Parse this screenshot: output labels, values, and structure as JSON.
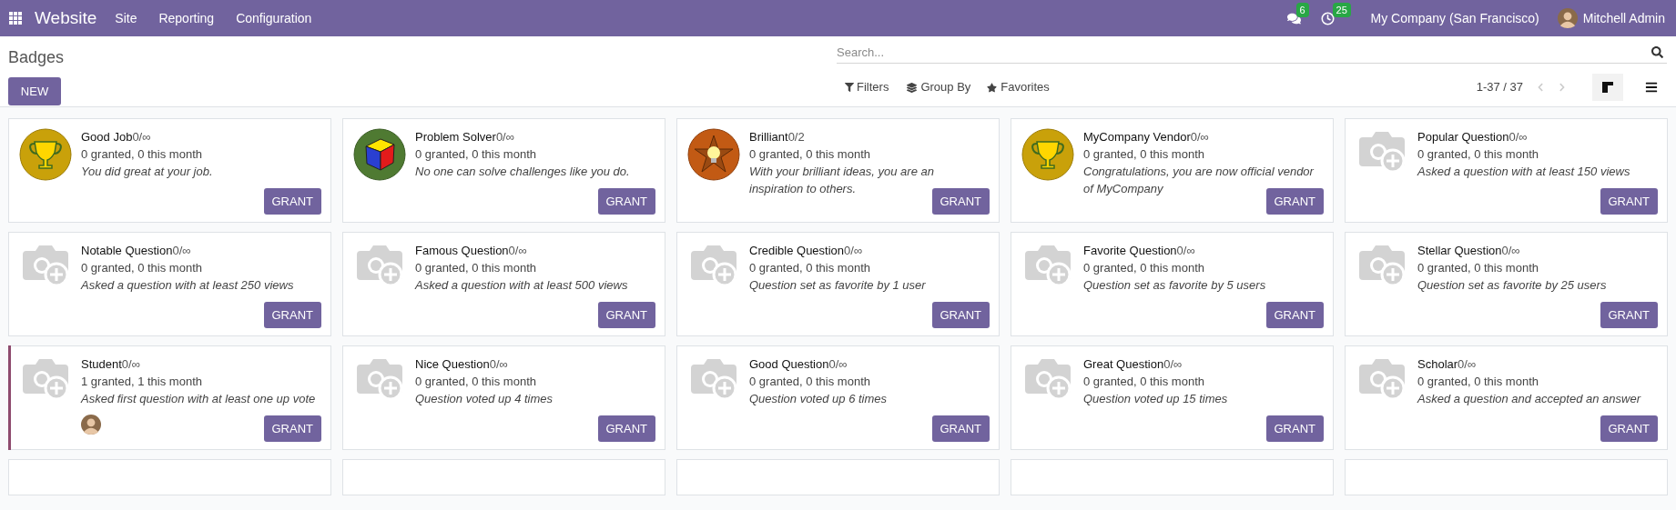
{
  "navbar": {
    "app": "Website",
    "menus": [
      "Site",
      "Reporting",
      "Configuration"
    ],
    "messages_count": "6",
    "activities_count": "25",
    "company": "My Company (San Francisco)",
    "user": "Mitchell Admin"
  },
  "control_panel": {
    "title": "Badges",
    "new_button": "NEW",
    "search": {
      "placeholder": "Search..."
    },
    "filters": "Filters",
    "group_by": "Group By",
    "favorites": "Favorites",
    "pager": "1-37 / 37",
    "views": [
      {
        "kind": "kanban",
        "selected": true
      },
      {
        "kind": "list",
        "selected": false
      }
    ]
  },
  "cards": [
    {
      "kind": "trophy",
      "name": "Good Job",
      "count": "0/∞",
      "granted": "0 granted, 0 this month",
      "description": "You did great at your job.",
      "button": "GRANT",
      "highlighted": false,
      "avatar": false
    },
    {
      "kind": "cube",
      "name": "Problem Solver",
      "count": "0/∞",
      "granted": "0 granted, 0 this month",
      "description": "No one can solve challenges like you do.",
      "button": "GRANT",
      "highlighted": false,
      "avatar": false
    },
    {
      "kind": "star",
      "name": "Brilliant",
      "count": "0/2",
      "granted": "0 granted, 0 this month",
      "description": "With your brilliant ideas, you are an inspiration to others.",
      "button": "GRANT",
      "highlighted": false,
      "avatar": false
    },
    {
      "kind": "trophy",
      "name": "MyCompany Vendor",
      "count": "0/∞",
      "granted": "0 granted, 0 this month",
      "description": "Congratulations, you are now official vendor of MyCompany",
      "button": "GRANT",
      "highlighted": false,
      "avatar": false
    },
    {
      "kind": "placeholder",
      "name": "Popular Question",
      "count": "0/∞",
      "granted": "0 granted, 0 this month",
      "description": "Asked a question with at least 150 views",
      "button": "GRANT",
      "highlighted": false,
      "avatar": false
    },
    {
      "kind": "placeholder",
      "name": "Notable Question",
      "count": "0/∞",
      "granted": "0 granted, 0 this month",
      "description": "Asked a question with at least 250 views",
      "button": "GRANT",
      "highlighted": false,
      "avatar": false
    },
    {
      "kind": "placeholder",
      "name": "Famous Question",
      "count": "0/∞",
      "granted": "0 granted, 0 this month",
      "description": "Asked a question with at least 500 views",
      "button": "GRANT",
      "highlighted": false,
      "avatar": false
    },
    {
      "kind": "placeholder",
      "name": "Credible Question",
      "count": "0/∞",
      "granted": "0 granted, 0 this month",
      "description": "Question set as favorite by 1 user",
      "button": "GRANT",
      "highlighted": false,
      "avatar": false
    },
    {
      "kind": "placeholder",
      "name": "Favorite Question",
      "count": "0/∞",
      "granted": "0 granted, 0 this month",
      "description": "Question set as favorite by 5 users",
      "button": "GRANT",
      "highlighted": false,
      "avatar": false
    },
    {
      "kind": "placeholder",
      "name": "Stellar Question",
      "count": "0/∞",
      "granted": "0 granted, 0 this month",
      "description": "Question set as favorite by 25 users",
      "button": "GRANT",
      "highlighted": false,
      "avatar": false
    },
    {
      "kind": "placeholder",
      "name": "Student",
      "count": "0/∞",
      "granted": "1 granted, 1 this month",
      "description": "Asked first question with at least one up vote",
      "button": "GRANT",
      "highlighted": true,
      "avatar": true
    },
    {
      "kind": "placeholder",
      "name": "Nice Question",
      "count": "0/∞",
      "granted": "0 granted, 0 this month",
      "description": "Question voted up 4 times",
      "button": "GRANT",
      "highlighted": false,
      "avatar": false
    },
    {
      "kind": "placeholder",
      "name": "Good Question",
      "count": "0/∞",
      "granted": "0 granted, 0 this month",
      "description": "Question voted up 6 times",
      "button": "GRANT",
      "highlighted": false,
      "avatar": false
    },
    {
      "kind": "placeholder",
      "name": "Great Question",
      "count": "0/∞",
      "granted": "0 granted, 0 this month",
      "description": "Question voted up 15 times",
      "button": "GRANT",
      "highlighted": false,
      "avatar": false
    },
    {
      "kind": "placeholder",
      "name": "Scholar",
      "count": "0/∞",
      "granted": "0 granted, 0 this month",
      "description": "Asked a question and accepted an answer",
      "button": "GRANT",
      "highlighted": false,
      "avatar": false
    }
  ]
}
